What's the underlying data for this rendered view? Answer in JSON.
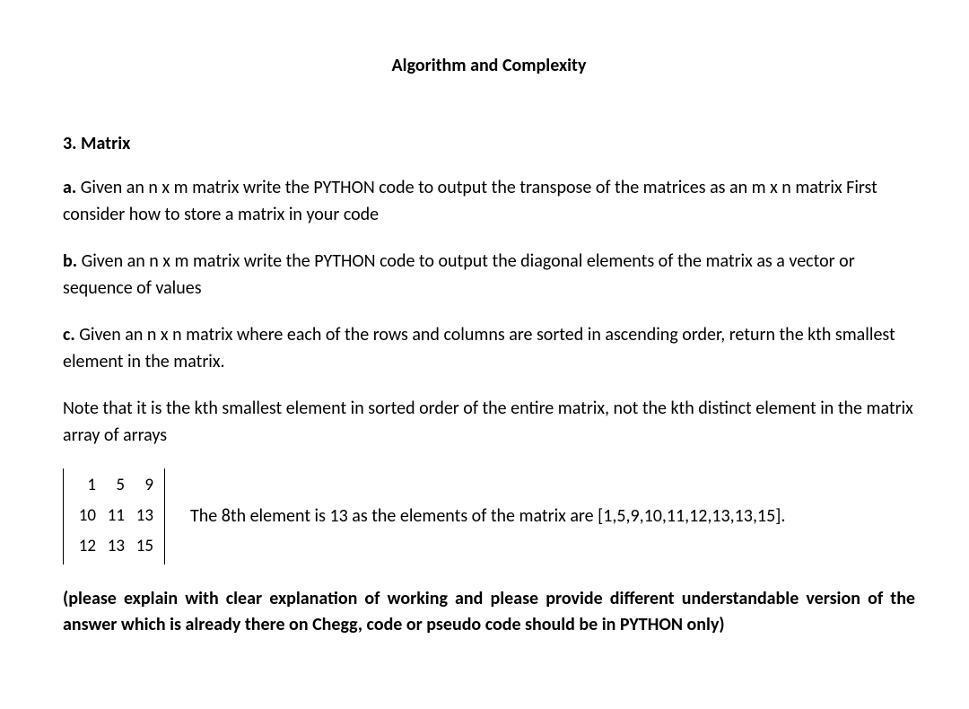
{
  "title": "Algorithm and Complexity",
  "heading": "3. Matrix",
  "parts": {
    "a": {
      "label": "a.",
      "text": " Given an n x m matrix write the PYTHON code to output the transpose of the matrices as an m x n matrix First consider how to store a matrix in your code"
    },
    "b": {
      "label": "b.",
      "text": " Given an n x m matrix write the PYTHON code to output the diagonal elements of the matrix as a vector or sequence of values"
    },
    "c": {
      "label": "c.",
      "text": " Given an n x n matrix where each of the rows and columns are sorted in ascending order, return the kth smallest element in the matrix."
    }
  },
  "note": "Note that it is the kth smallest element in sorted order of the entire matrix, not the kth distinct element in the matrix array of arrays",
  "matrix": {
    "r0": {
      "c0": "1",
      "c1": "5",
      "c2": "9"
    },
    "r1": {
      "c0": "10",
      "c1": "11",
      "c2": "13"
    },
    "r2": {
      "c0": "12",
      "c1": "13",
      "c2": "15"
    }
  },
  "matrix_note": "The 8th element is 13 as the elements of the matrix are [1,5,9,10,11,12,13,13,15].",
  "footer": "(please explain with clear explanation of working and please provide different understandable version of the answer which is already there on Chegg, code or pseudo code should be in PYTHON only)"
}
